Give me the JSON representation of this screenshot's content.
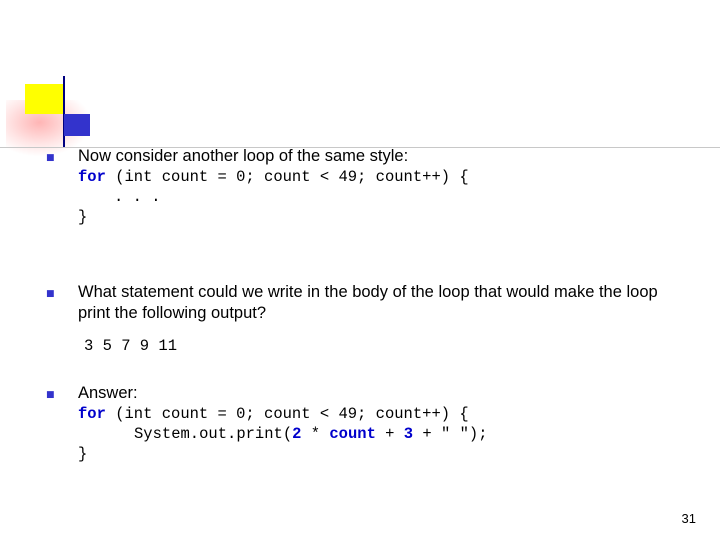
{
  "slide": {
    "number": "31",
    "bullet_glyph": "■",
    "bullets": [
      {
        "text": "Now consider another loop of the same style:",
        "code_lines": [
          {
            "indent": 0,
            "segments": [
              {
                "t": "for",
                "style": "kw"
              },
              {
                "t": " (int count = 0; count < 49; count++) {",
                "style": "plain"
              }
            ]
          },
          {
            "indent": 1,
            "segments": [
              {
                "t": ". . .",
                "style": "plain"
              }
            ]
          },
          {
            "indent": 0,
            "segments": [
              {
                "t": "}",
                "style": "plain"
              }
            ]
          }
        ]
      },
      {
        "text": "What statement could we write in the body of the loop that would make the loop print the following output?",
        "output": "3 5 7 9 11"
      },
      {
        "text": "Answer:",
        "code_lines": [
          {
            "indent": 0,
            "segments": [
              {
                "t": "for",
                "style": "kw"
              },
              {
                "t": " (int count = 0; count < 49; count++) {",
                "style": "plain"
              }
            ]
          },
          {
            "indent": 2,
            "segments": [
              {
                "t": "System.out.print(",
                "style": "plain"
              },
              {
                "t": "2",
                "style": "lit"
              },
              {
                "t": " * ",
                "style": "plain"
              },
              {
                "t": "count",
                "style": "lit"
              },
              {
                "t": " + ",
                "style": "plain"
              },
              {
                "t": "3",
                "style": "lit"
              },
              {
                "t": " + \" \");",
                "style": "plain"
              }
            ]
          },
          {
            "indent": 0,
            "segments": [
              {
                "t": "}",
                "style": "plain"
              }
            ]
          }
        ]
      }
    ]
  },
  "colors": {
    "accent_blue": "#3333cc",
    "accent_yellow": "#ffff00",
    "navy_rule": "#000080",
    "code_keyword": "#0000cc"
  }
}
